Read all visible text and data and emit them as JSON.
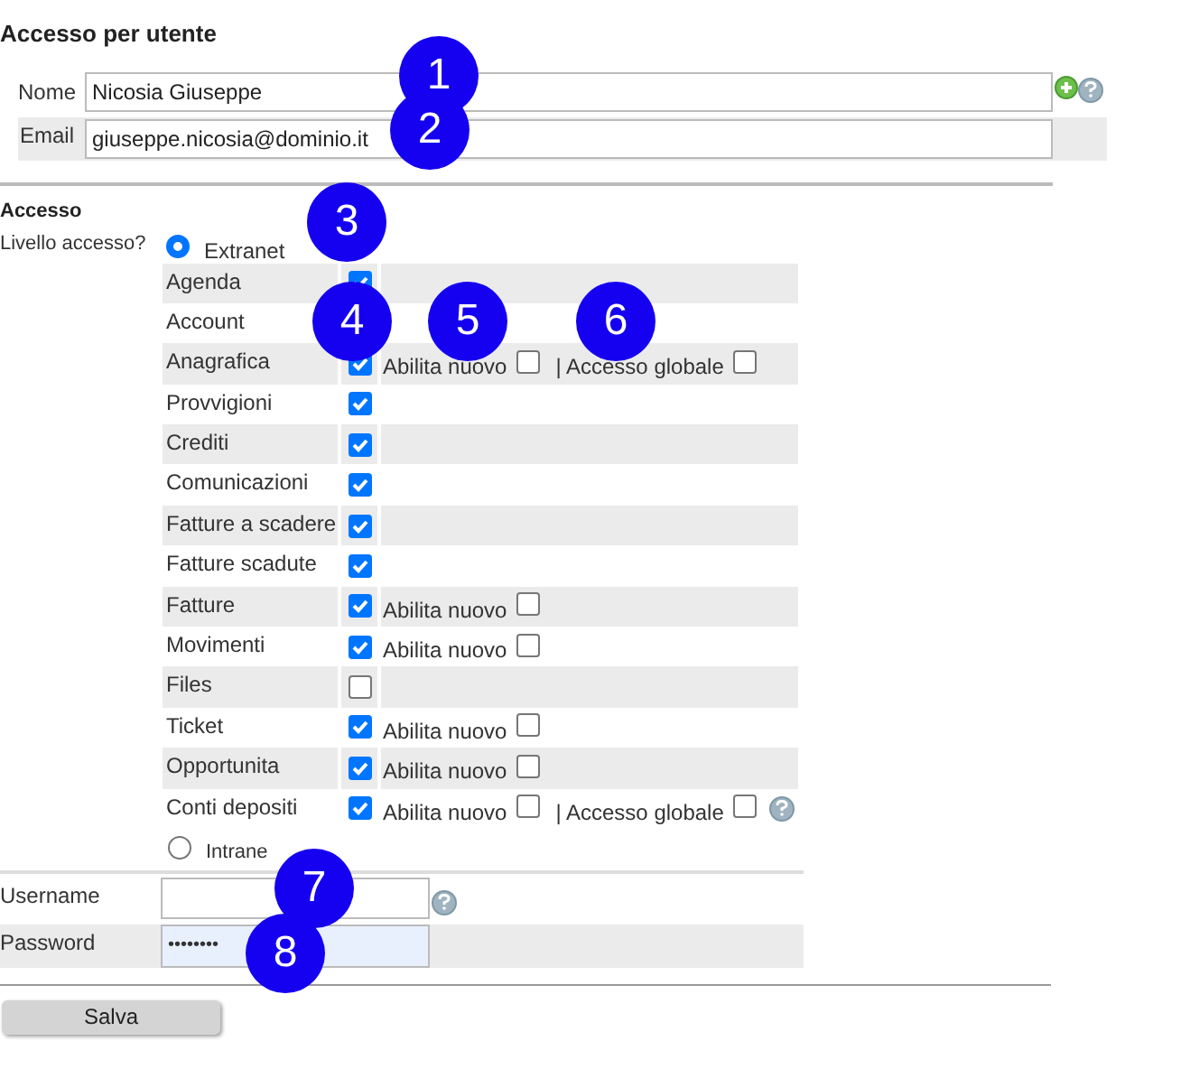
{
  "title": "Accesso per utente",
  "user": {
    "name_label": "Nome",
    "name_value": "Nicosia Giuseppe",
    "email_label": "Email",
    "email_value": "giuseppe.nicosia@dominio.it"
  },
  "access": {
    "heading": "Accesso",
    "level_label": "Livello accesso?",
    "levels": [
      {
        "label": "Extranet",
        "selected": true
      },
      {
        "label": "Intrane",
        "selected": false
      }
    ],
    "modules": [
      {
        "name": "Agenda",
        "checked": true
      },
      {
        "name": "Account"
      },
      {
        "name": "Anagrafica",
        "checked": true,
        "abilita_nuovo": {
          "label": "Abilita nuovo",
          "checked": false
        },
        "accesso_globale": {
          "label": "| Accesso globale",
          "checked": false
        }
      },
      {
        "name": "Provvigioni",
        "checked": true
      },
      {
        "name": "Crediti",
        "checked": true
      },
      {
        "name": "Comunicazioni",
        "checked": true
      },
      {
        "name": "Fatture a scadere",
        "checked": true
      },
      {
        "name": "Fatture scadute",
        "checked": true
      },
      {
        "name": "Fatture",
        "checked": true,
        "abilita_nuovo": {
          "label": "Abilita nuovo",
          "checked": false
        }
      },
      {
        "name": "Movimenti",
        "checked": true,
        "abilita_nuovo": {
          "label": "Abilita nuovo",
          "checked": false
        }
      },
      {
        "name": "Files",
        "checked": false
      },
      {
        "name": "Ticket",
        "checked": true,
        "abilita_nuovo": {
          "label": "Abilita nuovo",
          "checked": false
        }
      },
      {
        "name": "Opportunita",
        "checked": true,
        "abilita_nuovo": {
          "label": "Abilita nuovo",
          "checked": false
        }
      },
      {
        "name": "Conti depositi",
        "checked": true,
        "abilita_nuovo": {
          "label": "Abilita nuovo",
          "checked": false
        },
        "accesso_globale": {
          "label": "| Accesso globale",
          "checked": false
        },
        "help": true
      }
    ]
  },
  "credentials": {
    "username_label": "Username",
    "password_label": "Password",
    "password_value": "••••••••"
  },
  "save_button": "Salva",
  "callouts": [
    "1",
    "2",
    "3",
    "4",
    "5",
    "6",
    "7",
    "8"
  ]
}
